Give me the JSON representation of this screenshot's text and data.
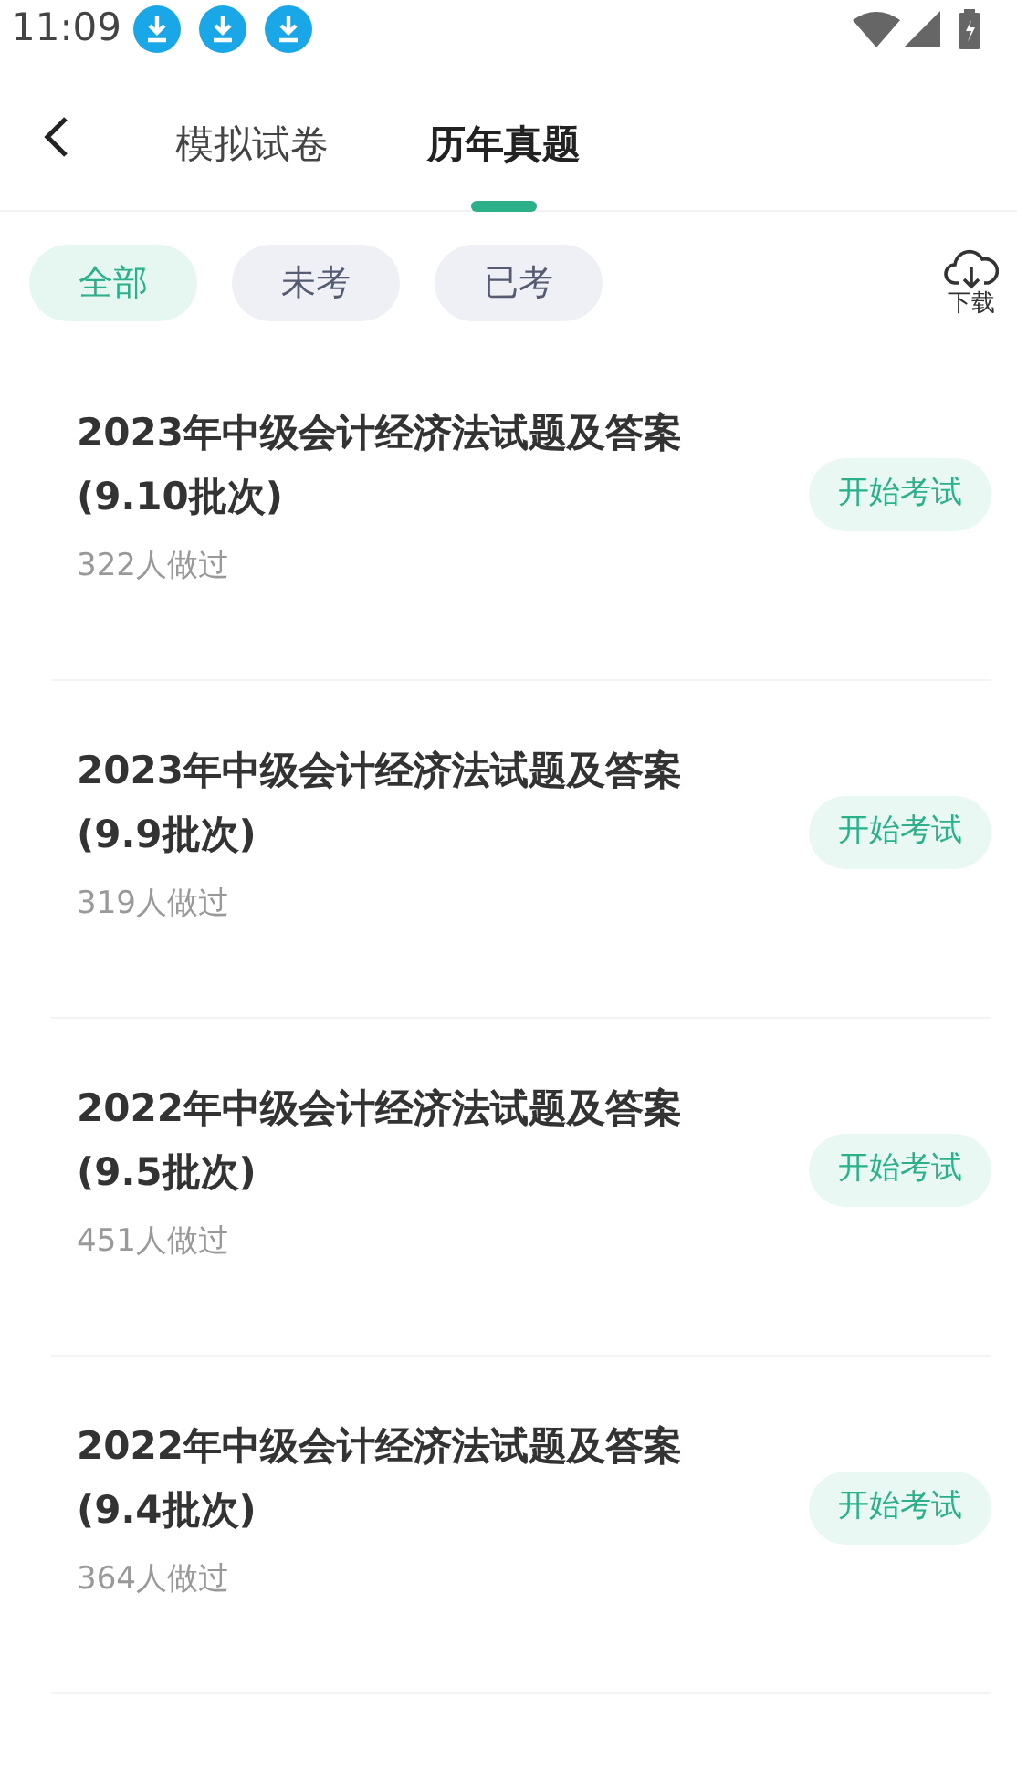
{
  "status_bar": {
    "time": "11:09",
    "notifications": [
      {
        "kind": "download"
      },
      {
        "kind": "download"
      },
      {
        "kind": "download"
      }
    ]
  },
  "tabs": [
    {
      "label": "模拟试卷",
      "selected": false
    },
    {
      "label": "历年真题",
      "selected": true
    }
  ],
  "filters": [
    {
      "label": "全部",
      "selected": true
    },
    {
      "label": "未考",
      "selected": false
    },
    {
      "label": "已考",
      "selected": false
    }
  ],
  "download": {
    "label": "下载"
  },
  "papers": [
    {
      "title": "2023年中级会计经济法试题及答案",
      "batch": "(9.10批次)",
      "count": "322人做过",
      "action": "开始考试"
    },
    {
      "title": "2023年中级会计经济法试题及答案",
      "batch": "(9.9批次)",
      "count": "319人做过",
      "action": "开始考试"
    },
    {
      "title": "2022年中级会计经济法试题及答案",
      "batch": "(9.5批次)",
      "count": "451人做过",
      "action": "开始考试"
    },
    {
      "title": "2022年中级会计经济法试题及答案",
      "batch": "(9.4批次)",
      "count": "364人做过",
      "action": "开始考试"
    }
  ]
}
